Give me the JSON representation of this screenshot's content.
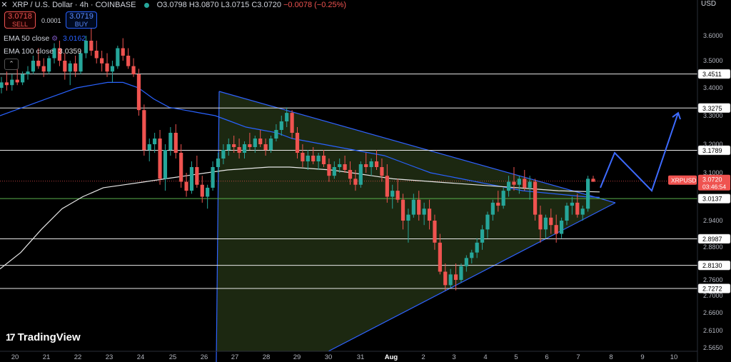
{
  "header": {
    "close_symbol": "✕",
    "title": "XRP / U.S. Dollar · 4h · COINBASE",
    "open": "O3.0798",
    "high": "H3.0870",
    "low": "L3.0715",
    "close": "C3.0720",
    "change": "−0.0078 (−0.25%)"
  },
  "trade": {
    "sell_price": "3.0718",
    "sell_label": "SELL",
    "spread": "0.0001",
    "buy_price": "3.0719",
    "buy_label": "BUY"
  },
  "indicators": [
    {
      "label": "EMA 50 close",
      "value": "3.0162"
    },
    {
      "label": "EMA 100 close",
      "value": "3.0359"
    }
  ],
  "currency": "USD",
  "brand": "TradingView",
  "price_tag": {
    "symbol": "XRPUSD",
    "price": "3.0720",
    "countdown": "03:46:54"
  },
  "colors": {
    "up": "#26a69a",
    "down": "#ef5350",
    "ema50": "#2962ff",
    "ema100": "#e6e6e6",
    "triangle_fill": "#1d2a12",
    "triangle_line": "#2f62ff",
    "projection": "#3d6bff",
    "level_line": "#e8e8e8",
    "green_line": "#59b04d"
  },
  "chart_data": {
    "type": "candlestick",
    "title": "XRP / U.S. Dollar · 4h · COINBASE",
    "x_tick_labels": [
      "20",
      "21",
      "22",
      "23",
      "24",
      "25",
      "26",
      "27",
      "28",
      "29",
      "30",
      "31",
      "Aug",
      "2",
      "3",
      "4",
      "5",
      "6",
      "7",
      "8",
      "9",
      "10"
    ],
    "y_tick_labels": [
      "3.6000",
      "3.5000",
      "3.4000",
      "3.3000",
      "3.2000",
      "3.1000",
      "2.9400",
      "2.8800",
      "2.7600",
      "2.7000",
      "2.6600",
      "2.6100",
      "2.5650"
    ],
    "ylim": [
      2.565,
      3.67
    ],
    "horizontal_levels": [
      3.4511,
      3.3275,
      3.1789,
      3.0137,
      2.8987,
      2.813,
      2.7272
    ],
    "current_price": 3.072,
    "candles": [
      [
        3.4,
        3.44,
        3.38,
        3.42
      ],
      [
        3.42,
        3.46,
        3.39,
        3.41
      ],
      [
        3.41,
        3.45,
        3.39,
        3.43
      ],
      [
        3.43,
        3.47,
        3.41,
        3.42
      ],
      [
        3.42,
        3.46,
        3.41,
        3.45
      ],
      [
        3.45,
        3.48,
        3.43,
        3.46
      ],
      [
        3.46,
        3.52,
        3.45,
        3.5
      ],
      [
        3.5,
        3.55,
        3.47,
        3.48
      ],
      [
        3.48,
        3.51,
        3.44,
        3.46
      ],
      [
        3.46,
        3.52,
        3.45,
        3.51
      ],
      [
        3.51,
        3.57,
        3.49,
        3.55
      ],
      [
        3.55,
        3.58,
        3.48,
        3.5
      ],
      [
        3.5,
        3.53,
        3.43,
        3.46
      ],
      [
        3.46,
        3.5,
        3.41,
        3.49
      ],
      [
        3.49,
        3.52,
        3.44,
        3.46
      ],
      [
        3.46,
        3.54,
        3.45,
        3.53
      ],
      [
        3.53,
        3.6,
        3.51,
        3.58
      ],
      [
        3.58,
        3.62,
        3.52,
        3.54
      ],
      [
        3.54,
        3.58,
        3.49,
        3.51
      ],
      [
        3.51,
        3.54,
        3.46,
        3.49
      ],
      [
        3.49,
        3.53,
        3.44,
        3.46
      ],
      [
        3.46,
        3.5,
        3.42,
        3.48
      ],
      [
        3.48,
        3.56,
        3.47,
        3.55
      ],
      [
        3.55,
        3.59,
        3.5,
        3.52
      ],
      [
        3.52,
        3.55,
        3.47,
        3.48
      ],
      [
        3.48,
        3.51,
        3.44,
        3.45
      ],
      [
        3.45,
        3.47,
        3.3,
        3.32
      ],
      [
        3.32,
        3.34,
        3.16,
        3.18
      ],
      [
        3.18,
        3.22,
        3.14,
        3.2
      ],
      [
        3.2,
        3.24,
        3.17,
        3.22
      ],
      [
        3.22,
        3.25,
        3.06,
        3.08
      ],
      [
        3.08,
        3.2,
        3.04,
        3.18
      ],
      [
        3.18,
        3.26,
        3.16,
        3.24
      ],
      [
        3.24,
        3.27,
        3.15,
        3.17
      ],
      [
        3.17,
        3.2,
        3.05,
        3.07
      ],
      [
        3.07,
        3.1,
        3.02,
        3.04
      ],
      [
        3.04,
        3.14,
        3.03,
        3.12
      ],
      [
        3.12,
        3.16,
        3.05,
        3.06
      ],
      [
        3.06,
        3.09,
        3.0,
        3.02
      ],
      [
        3.02,
        3.06,
        2.98,
        3.05
      ],
      [
        3.05,
        3.14,
        3.04,
        3.12
      ],
      [
        3.12,
        3.17,
        3.1,
        3.15
      ],
      [
        3.15,
        3.2,
        3.13,
        3.18
      ],
      [
        3.18,
        3.22,
        3.16,
        3.2
      ],
      [
        3.2,
        3.23,
        3.17,
        3.19
      ],
      [
        3.19,
        3.22,
        3.15,
        3.17
      ],
      [
        3.17,
        3.21,
        3.15,
        3.2
      ],
      [
        3.2,
        3.24,
        3.18,
        3.19
      ],
      [
        3.19,
        3.23,
        3.17,
        3.22
      ],
      [
        3.22,
        3.25,
        3.19,
        3.2
      ],
      [
        3.2,
        3.22,
        3.16,
        3.18
      ],
      [
        3.18,
        3.23,
        3.17,
        3.22
      ],
      [
        3.22,
        3.27,
        3.21,
        3.25
      ],
      [
        3.25,
        3.3,
        3.23,
        3.28
      ],
      [
        3.28,
        3.33,
        3.26,
        3.31
      ],
      [
        3.31,
        3.32,
        3.22,
        3.24
      ],
      [
        3.24,
        3.26,
        3.15,
        3.17
      ],
      [
        3.17,
        3.2,
        3.12,
        3.14
      ],
      [
        3.14,
        3.18,
        3.11,
        3.16
      ],
      [
        3.16,
        3.19,
        3.13,
        3.14
      ],
      [
        3.14,
        3.17,
        3.11,
        3.16
      ],
      [
        3.16,
        3.18,
        3.12,
        3.13
      ],
      [
        3.13,
        3.15,
        3.07,
        3.09
      ],
      [
        3.09,
        3.14,
        3.08,
        3.12
      ],
      [
        3.12,
        3.15,
        3.1,
        3.13
      ],
      [
        3.13,
        3.16,
        3.1,
        3.11
      ],
      [
        3.11,
        3.14,
        3.06,
        3.08
      ],
      [
        3.08,
        3.11,
        3.04,
        3.06
      ],
      [
        3.06,
        3.14,
        3.05,
        3.13
      ],
      [
        3.13,
        3.17,
        3.1,
        3.12
      ],
      [
        3.12,
        3.15,
        3.09,
        3.14
      ],
      [
        3.14,
        3.18,
        3.11,
        3.12
      ],
      [
        3.12,
        3.15,
        3.07,
        3.09
      ],
      [
        3.09,
        3.13,
        3.0,
        3.02
      ],
      [
        3.02,
        3.06,
        2.98,
        3.04
      ],
      [
        3.04,
        3.08,
        3.0,
        3.01
      ],
      [
        3.01,
        3.03,
        2.92,
        2.94
      ],
      [
        2.94,
        2.98,
        2.89,
        2.96
      ],
      [
        2.96,
        3.03,
        2.95,
        3.01
      ],
      [
        3.01,
        3.04,
        2.94,
        2.96
      ],
      [
        2.96,
        3.0,
        2.93,
        2.98
      ],
      [
        2.98,
        3.01,
        2.92,
        2.94
      ],
      [
        2.94,
        2.96,
        2.87,
        2.89
      ],
      [
        2.89,
        2.91,
        2.78,
        2.79
      ],
      [
        2.79,
        2.82,
        2.72,
        2.74
      ],
      [
        2.74,
        2.8,
        2.73,
        2.78
      ],
      [
        2.78,
        2.82,
        2.72,
        2.76
      ],
      [
        2.76,
        2.82,
        2.75,
        2.81
      ],
      [
        2.81,
        2.85,
        2.79,
        2.84
      ],
      [
        2.84,
        2.87,
        2.82,
        2.86
      ],
      [
        2.86,
        2.9,
        2.84,
        2.89
      ],
      [
        2.89,
        2.93,
        2.87,
        2.92
      ],
      [
        2.92,
        2.97,
        2.9,
        2.96
      ],
      [
        2.96,
        3.01,
        2.94,
        3.0
      ],
      [
        3.0,
        3.04,
        2.97,
        2.99
      ],
      [
        2.99,
        3.05,
        2.98,
        3.04
      ],
      [
        3.04,
        3.09,
        3.02,
        3.07
      ],
      [
        3.07,
        3.12,
        3.04,
        3.06
      ],
      [
        3.06,
        3.09,
        3.03,
        3.08
      ],
      [
        3.08,
        3.11,
        3.04,
        3.05
      ],
      [
        3.05,
        3.09,
        3.01,
        3.07
      ],
      [
        3.07,
        3.08,
        2.94,
        2.96
      ],
      [
        2.96,
        2.99,
        2.89,
        2.92
      ],
      [
        2.92,
        2.96,
        2.9,
        2.95
      ],
      [
        2.95,
        2.98,
        2.91,
        2.93
      ],
      [
        2.93,
        2.96,
        2.89,
        2.91
      ],
      [
        2.91,
        2.95,
        2.9,
        2.94
      ],
      [
        2.94,
        3.0,
        2.93,
        2.99
      ],
      [
        2.99,
        3.02,
        2.96,
        3.0
      ],
      [
        3.0,
        3.03,
        2.95,
        2.96
      ],
      [
        2.96,
        2.99,
        2.94,
        2.98
      ],
      [
        2.98,
        3.09,
        2.97,
        3.08
      ],
      [
        3.08,
        3.09,
        3.07,
        3.07
      ]
    ],
    "ema_50": [
      3.3,
      3.32,
      3.34,
      3.36,
      3.38,
      3.4,
      3.41,
      3.42,
      3.42,
      3.4,
      3.36,
      3.33,
      3.32,
      3.31,
      3.3,
      3.28,
      3.26,
      3.25,
      3.24,
      3.22,
      3.21,
      3.2,
      3.19,
      3.18,
      3.17,
      3.16,
      3.14,
      3.12,
      3.1,
      3.09,
      3.08,
      3.07,
      3.06,
      3.05,
      3.04,
      3.035,
      3.03,
      3.025,
      3.02,
      3.018
    ],
    "ema_100": [
      2.8,
      2.86,
      2.92,
      2.98,
      3.02,
      3.05,
      3.06,
      3.07,
      3.08,
      3.09,
      3.1,
      3.11,
      3.115,
      3.12,
      3.12,
      3.115,
      3.11,
      3.1,
      3.09,
      3.08,
      3.075,
      3.07,
      3.065,
      3.06,
      3.055,
      3.05,
      3.045,
      3.04,
      3.038,
      3.036
    ],
    "triangle": {
      "upper_line": [
        [
          27,
          3.42
        ],
        [
          8,
          3.01
        ]
      ],
      "lower_line": [
        [
          30,
          2.57
        ],
        [
          8,
          3.01
        ]
      ],
      "left_edge_date": "27"
    },
    "projection_path": [
      [
        7.8,
        3.05
      ],
      [
        8.1,
        3.17
      ],
      [
        9.3,
        3.04
      ],
      [
        10.2,
        3.31
      ]
    ],
    "grid": false,
    "legend": "top-left"
  }
}
